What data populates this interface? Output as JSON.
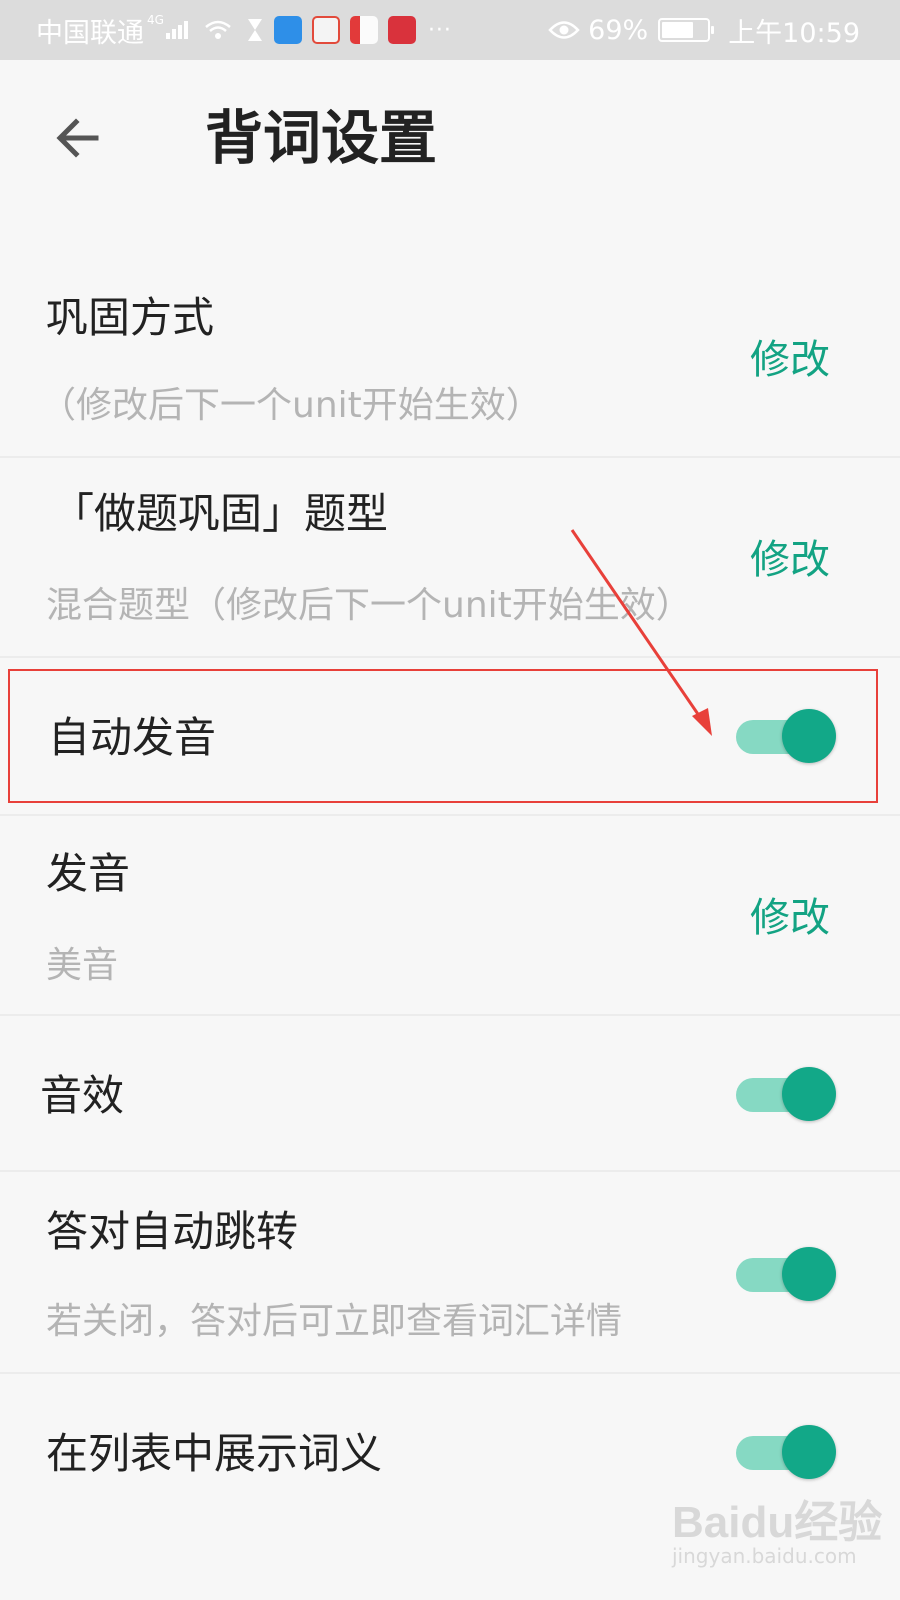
{
  "status_bar": {
    "carrier": "中国联通",
    "network": "4G",
    "more": "···",
    "battery_percent": "69%",
    "time": "上午10:59"
  },
  "header": {
    "title": "背词设置",
    "back_icon": "back-arrow-icon"
  },
  "settings": {
    "consolidation_method": {
      "title": "巩固方式",
      "subtitle": "（修改后下一个unit开始生效）",
      "action": "修改"
    },
    "exercise_type": {
      "title": "「做题巩固」题型",
      "subtitle": "混合题型（修改后下一个unit开始生效）",
      "action": "修改"
    },
    "auto_pronounce": {
      "title": "自动发音",
      "enabled": true
    },
    "pronunciation": {
      "title": "发音",
      "subtitle": "美音",
      "action": "修改"
    },
    "sound_effects": {
      "title": "音效",
      "enabled": true
    },
    "auto_jump": {
      "title": "答对自动跳转",
      "subtitle": "若关闭，答对后可立即查看词汇详情",
      "enabled": true
    },
    "show_meaning_in_list": {
      "title": "在列表中展示词义",
      "enabled": true
    }
  },
  "colors": {
    "accent": "#13a383",
    "toggle_track": "#86d9c3",
    "toggle_knob": "#12a888",
    "highlight": "#e8403a"
  },
  "watermark": {
    "main": "Baidu经验",
    "sub": "jingyan.baidu.com"
  }
}
